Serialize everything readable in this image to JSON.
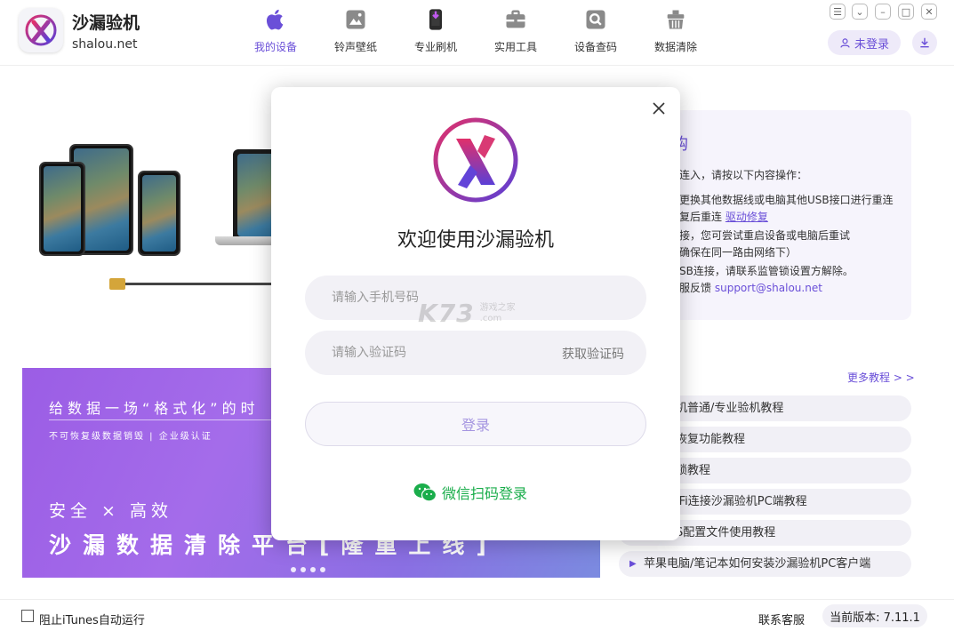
{
  "app": {
    "name": "沙漏验机",
    "domain": "shalou.net"
  },
  "nav": [
    {
      "label": "我的设备",
      "icon": "apple-icon",
      "active": true
    },
    {
      "label": "铃声壁纸",
      "icon": "wallpaper-icon",
      "active": false
    },
    {
      "label": "专业刷机",
      "icon": "flash-phone-icon",
      "active": false
    },
    {
      "label": "实用工具",
      "icon": "toolbox-icon",
      "active": false
    },
    {
      "label": "设备查码",
      "icon": "search-device-icon",
      "active": false
    },
    {
      "label": "数据清除",
      "icon": "erase-icon",
      "active": false
    }
  ],
  "header": {
    "login_label": "未登录"
  },
  "help": {
    "title": "购",
    "intro": "连入，请按以下内容操作：",
    "lines": [
      "更换其他数据线或电脑其他USB接口进行重连",
      "复后重连",
      "接，您可尝试重启设备或电脑后重试",
      "确保在同一路由网络下）",
      "SB连接，请联系监管锁设置方解除。",
      "服反馈"
    ],
    "driver_link": "驱动修复",
    "email": "support@shalou.net"
  },
  "tutorials": {
    "more_label": "更多教程 > >",
    "items": [
      "机普通/专业验机教程",
      "恢复功能教程",
      "锁教程",
      "iFi连接沙漏验机PC端教程",
      "S配置文件使用教程",
      "苹果电脑/笔记本如何安装沙漏验机PC客户端"
    ]
  },
  "banner": {
    "line1": "给数据一场“格式化”的时",
    "line2": "不可恢复级数据销毁 | 企业级认证",
    "line3": "安全 × 高效",
    "line4": "沙漏数据清除平台[隆重上线]"
  },
  "footer": {
    "itunes_label": "阻止iTunes自动运行",
    "contact": "联系客服",
    "version": "当前版本: 7.11.1"
  },
  "modal": {
    "title": "欢迎使用沙漏验机",
    "phone_placeholder": "请输入手机号码",
    "code_placeholder": "请输入验证码",
    "get_code": "获取验证码",
    "login_button": "登录",
    "wechat_login": "微信扫码登录"
  },
  "watermark": {
    "big": "K73",
    "small_top": "游戏之家",
    "small_bottom": ".com"
  },
  "colors": {
    "accent": "#6a4fd8",
    "wechat": "#1aad4b",
    "banner": "#9b5de5"
  }
}
